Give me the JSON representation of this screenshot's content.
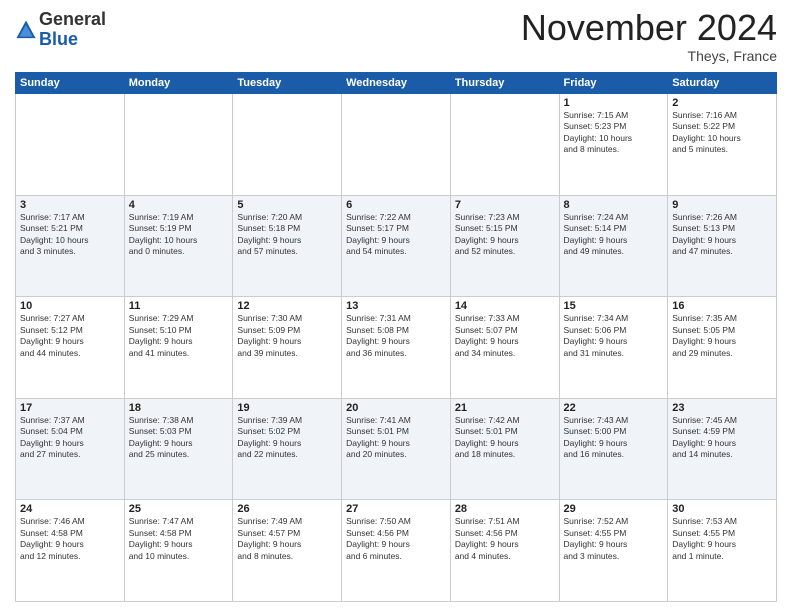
{
  "logo": {
    "general": "General",
    "blue": "Blue"
  },
  "header": {
    "month": "November 2024",
    "location": "Theys, France"
  },
  "weekdays": [
    "Sunday",
    "Monday",
    "Tuesday",
    "Wednesday",
    "Thursday",
    "Friday",
    "Saturday"
  ],
  "weeks": [
    [
      {
        "day": "",
        "info": ""
      },
      {
        "day": "",
        "info": ""
      },
      {
        "day": "",
        "info": ""
      },
      {
        "day": "",
        "info": ""
      },
      {
        "day": "",
        "info": ""
      },
      {
        "day": "1",
        "info": "Sunrise: 7:15 AM\nSunset: 5:23 PM\nDaylight: 10 hours\nand 8 minutes."
      },
      {
        "day": "2",
        "info": "Sunrise: 7:16 AM\nSunset: 5:22 PM\nDaylight: 10 hours\nand 5 minutes."
      }
    ],
    [
      {
        "day": "3",
        "info": "Sunrise: 7:17 AM\nSunset: 5:21 PM\nDaylight: 10 hours\nand 3 minutes."
      },
      {
        "day": "4",
        "info": "Sunrise: 7:19 AM\nSunset: 5:19 PM\nDaylight: 10 hours\nand 0 minutes."
      },
      {
        "day": "5",
        "info": "Sunrise: 7:20 AM\nSunset: 5:18 PM\nDaylight: 9 hours\nand 57 minutes."
      },
      {
        "day": "6",
        "info": "Sunrise: 7:22 AM\nSunset: 5:17 PM\nDaylight: 9 hours\nand 54 minutes."
      },
      {
        "day": "7",
        "info": "Sunrise: 7:23 AM\nSunset: 5:15 PM\nDaylight: 9 hours\nand 52 minutes."
      },
      {
        "day": "8",
        "info": "Sunrise: 7:24 AM\nSunset: 5:14 PM\nDaylight: 9 hours\nand 49 minutes."
      },
      {
        "day": "9",
        "info": "Sunrise: 7:26 AM\nSunset: 5:13 PM\nDaylight: 9 hours\nand 47 minutes."
      }
    ],
    [
      {
        "day": "10",
        "info": "Sunrise: 7:27 AM\nSunset: 5:12 PM\nDaylight: 9 hours\nand 44 minutes."
      },
      {
        "day": "11",
        "info": "Sunrise: 7:29 AM\nSunset: 5:10 PM\nDaylight: 9 hours\nand 41 minutes."
      },
      {
        "day": "12",
        "info": "Sunrise: 7:30 AM\nSunset: 5:09 PM\nDaylight: 9 hours\nand 39 minutes."
      },
      {
        "day": "13",
        "info": "Sunrise: 7:31 AM\nSunset: 5:08 PM\nDaylight: 9 hours\nand 36 minutes."
      },
      {
        "day": "14",
        "info": "Sunrise: 7:33 AM\nSunset: 5:07 PM\nDaylight: 9 hours\nand 34 minutes."
      },
      {
        "day": "15",
        "info": "Sunrise: 7:34 AM\nSunset: 5:06 PM\nDaylight: 9 hours\nand 31 minutes."
      },
      {
        "day": "16",
        "info": "Sunrise: 7:35 AM\nSunset: 5:05 PM\nDaylight: 9 hours\nand 29 minutes."
      }
    ],
    [
      {
        "day": "17",
        "info": "Sunrise: 7:37 AM\nSunset: 5:04 PM\nDaylight: 9 hours\nand 27 minutes."
      },
      {
        "day": "18",
        "info": "Sunrise: 7:38 AM\nSunset: 5:03 PM\nDaylight: 9 hours\nand 25 minutes."
      },
      {
        "day": "19",
        "info": "Sunrise: 7:39 AM\nSunset: 5:02 PM\nDaylight: 9 hours\nand 22 minutes."
      },
      {
        "day": "20",
        "info": "Sunrise: 7:41 AM\nSunset: 5:01 PM\nDaylight: 9 hours\nand 20 minutes."
      },
      {
        "day": "21",
        "info": "Sunrise: 7:42 AM\nSunset: 5:01 PM\nDaylight: 9 hours\nand 18 minutes."
      },
      {
        "day": "22",
        "info": "Sunrise: 7:43 AM\nSunset: 5:00 PM\nDaylight: 9 hours\nand 16 minutes."
      },
      {
        "day": "23",
        "info": "Sunrise: 7:45 AM\nSunset: 4:59 PM\nDaylight: 9 hours\nand 14 minutes."
      }
    ],
    [
      {
        "day": "24",
        "info": "Sunrise: 7:46 AM\nSunset: 4:58 PM\nDaylight: 9 hours\nand 12 minutes."
      },
      {
        "day": "25",
        "info": "Sunrise: 7:47 AM\nSunset: 4:58 PM\nDaylight: 9 hours\nand 10 minutes."
      },
      {
        "day": "26",
        "info": "Sunrise: 7:49 AM\nSunset: 4:57 PM\nDaylight: 9 hours\nand 8 minutes."
      },
      {
        "day": "27",
        "info": "Sunrise: 7:50 AM\nSunset: 4:56 PM\nDaylight: 9 hours\nand 6 minutes."
      },
      {
        "day": "28",
        "info": "Sunrise: 7:51 AM\nSunset: 4:56 PM\nDaylight: 9 hours\nand 4 minutes."
      },
      {
        "day": "29",
        "info": "Sunrise: 7:52 AM\nSunset: 4:55 PM\nDaylight: 9 hours\nand 3 minutes."
      },
      {
        "day": "30",
        "info": "Sunrise: 7:53 AM\nSunset: 4:55 PM\nDaylight: 9 hours\nand 1 minute."
      }
    ]
  ]
}
